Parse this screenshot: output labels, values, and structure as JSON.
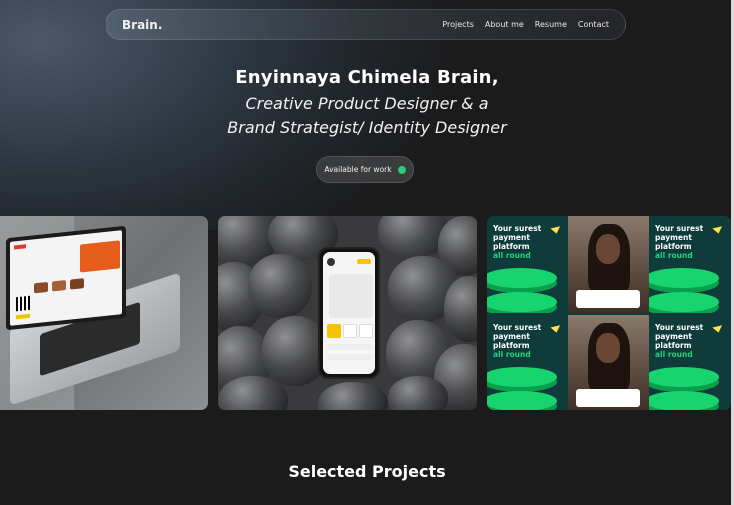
{
  "nav": {
    "brand": "Brain.",
    "links": [
      "Projects",
      "About me",
      "Resume",
      "Contact"
    ]
  },
  "hero": {
    "name": "Enyinnaya Chimela Brain,",
    "role_line1": "Creative Product Designer & a",
    "role_line2": "Brand Strategist/ Identity Designer",
    "availability_label": "Available for work",
    "availability_color": "#2ecc71"
  },
  "showcase": {
    "card3_headline": "Your surest",
    "card3_headline2": "payment platform",
    "card3_highlight": "all round"
  },
  "sections": {
    "selected_projects": "Selected Projects"
  },
  "colors": {
    "background": "#1b1b1c",
    "accent_green": "#22d37a"
  }
}
